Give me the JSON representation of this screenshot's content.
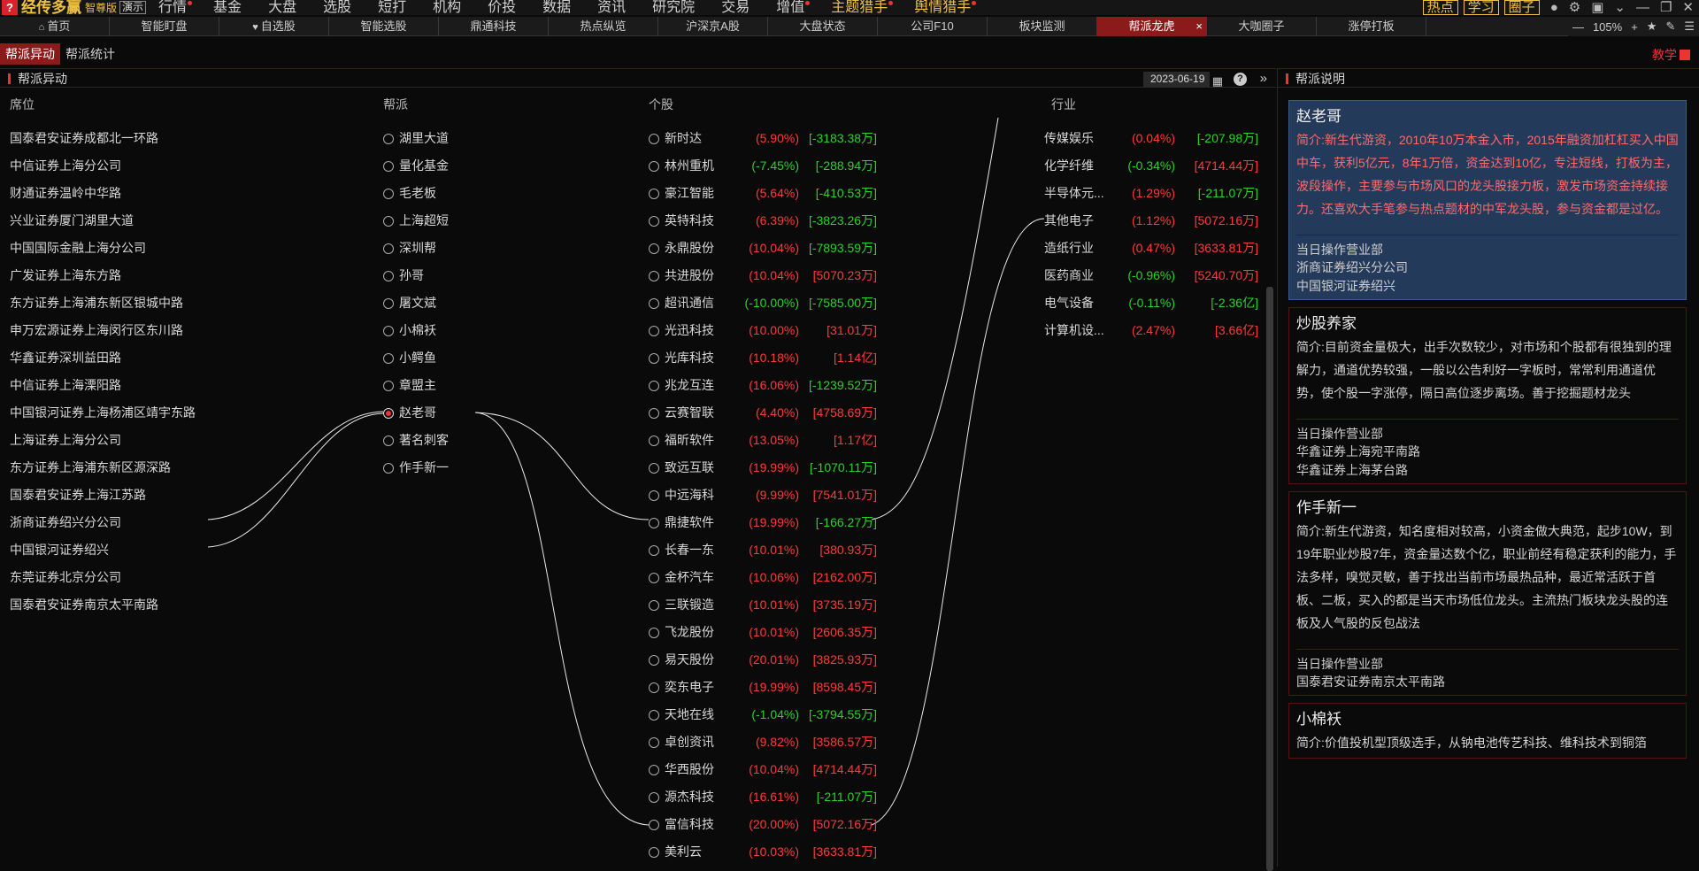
{
  "app": {
    "logo_mark": "?",
    "name": "经传多赢",
    "edition": "智尊版",
    "demo": "演示"
  },
  "menu": [
    {
      "label": "行情",
      "dot": true,
      "yellow": false
    },
    {
      "label": "基金",
      "dot": false,
      "yellow": false
    },
    {
      "label": "大盘",
      "dot": false,
      "yellow": false
    },
    {
      "label": "选股",
      "dot": false,
      "yellow": false
    },
    {
      "label": "短打",
      "dot": false,
      "yellow": false
    },
    {
      "label": "机构",
      "dot": false,
      "yellow": false
    },
    {
      "label": "价投",
      "dot": false,
      "yellow": false
    },
    {
      "label": "数据",
      "dot": false,
      "yellow": false
    },
    {
      "label": "资讯",
      "dot": false,
      "yellow": false
    },
    {
      "label": "研究院",
      "dot": false,
      "yellow": false
    },
    {
      "label": "交易",
      "dot": false,
      "yellow": false
    },
    {
      "label": "增值",
      "dot": true,
      "yellow": false
    },
    {
      "label": "主题猎手",
      "dot": true,
      "yellow": true
    },
    {
      "label": "舆情猎手",
      "dot": true,
      "yellow": true
    }
  ],
  "top_buttons": [
    "热点",
    "学习",
    "圈子"
  ],
  "tabs": [
    {
      "label": "首页",
      "icon": "⌂",
      "active": false
    },
    {
      "label": "智能盯盘",
      "icon": "",
      "active": false
    },
    {
      "label": "自选股",
      "icon": "♥",
      "active": false
    },
    {
      "label": "智能选股",
      "icon": "",
      "active": false
    },
    {
      "label": "鼎通科技",
      "icon": "",
      "active": false
    },
    {
      "label": "热点纵览",
      "icon": "",
      "active": false
    },
    {
      "label": "沪深京A股",
      "icon": "",
      "active": false
    },
    {
      "label": "大盘状态",
      "icon": "",
      "active": false
    },
    {
      "label": "公司F10",
      "icon": "",
      "active": false
    },
    {
      "label": "板块监测",
      "icon": "",
      "active": false
    },
    {
      "label": "帮派龙虎",
      "icon": "",
      "active": true
    },
    {
      "label": "大咖圈子",
      "icon": "",
      "active": false
    },
    {
      "label": "涨停打板",
      "icon": "",
      "active": false
    }
  ],
  "zoom": {
    "value": "105%"
  },
  "subtabs": [
    {
      "label": "帮派异动",
      "active": true
    },
    {
      "label": "帮派统计",
      "active": false
    }
  ],
  "teach_label": "教学",
  "left_panel": {
    "title": "帮派异动",
    "date": "2023-06-19",
    "col_headers": {
      "seat": "席位",
      "faction": "帮派",
      "stock": "个股",
      "industry": "行业"
    }
  },
  "seats": [
    "国泰君安证券成都北一环路",
    "中信证券上海分公司",
    "财通证券温岭中华路",
    "兴业证券厦门湖里大道",
    "中国国际金融上海分公司",
    "广发证券上海东方路",
    "东方证券上海浦东新区银城中路",
    "申万宏源证券上海闵行区东川路",
    "华鑫证券深圳益田路",
    "中信证券上海溧阳路",
    "中国银河证券上海杨浦区靖宇东路",
    "上海证券上海分公司",
    "东方证券上海浦东新区源深路",
    "国泰君安证券上海江苏路",
    "浙商证券绍兴分公司",
    "中国银河证券绍兴",
    "东莞证券北京分公司",
    "国泰君安证券南京太平南路"
  ],
  "factions": [
    {
      "name": "湖里大道",
      "selected": false
    },
    {
      "name": "量化基金",
      "selected": false
    },
    {
      "name": "毛老板",
      "selected": false
    },
    {
      "name": "上海超短",
      "selected": false
    },
    {
      "name": "深圳帮",
      "selected": false
    },
    {
      "name": "孙哥",
      "selected": false
    },
    {
      "name": "屠文斌",
      "selected": false
    },
    {
      "name": "小棉袄",
      "selected": false
    },
    {
      "name": "小鳄鱼",
      "selected": false
    },
    {
      "name": "章盟主",
      "selected": false
    },
    {
      "name": "赵老哥",
      "selected": true
    },
    {
      "name": "著名刺客",
      "selected": false
    },
    {
      "name": "作手新一",
      "selected": false
    }
  ],
  "stocks": [
    {
      "name": "新时达",
      "pct": "(5.90%)",
      "amt": "[-3183.38万]",
      "pct_color": "red",
      "amt_color": "green"
    },
    {
      "name": "林州重机",
      "pct": "(-7.45%)",
      "amt": "[-288.94万]",
      "pct_color": "green",
      "amt_color": "green"
    },
    {
      "name": "豪江智能",
      "pct": "(5.64%)",
      "amt": "[-410.53万]",
      "pct_color": "red",
      "amt_color": "green"
    },
    {
      "name": "英特科技",
      "pct": "(6.39%)",
      "amt": "[-3823.26万]",
      "pct_color": "red",
      "amt_color": "green"
    },
    {
      "name": "永鼎股份",
      "pct": "(10.04%)",
      "amt": "[-7893.59万]",
      "pct_color": "red",
      "amt_color": "green"
    },
    {
      "name": "共进股份",
      "pct": "(10.04%)",
      "amt": "[5070.23万]",
      "pct_color": "red",
      "amt_color": "red"
    },
    {
      "name": "超讯通信",
      "pct": "(-10.00%)",
      "amt": "[-7585.00万]",
      "pct_color": "green",
      "amt_color": "green"
    },
    {
      "name": "光迅科技",
      "pct": "(10.00%)",
      "amt": "[31.01万]",
      "pct_color": "red",
      "amt_color": "red"
    },
    {
      "name": "光库科技",
      "pct": "(10.18%)",
      "amt": "[1.14亿]",
      "pct_color": "red",
      "amt_color": "red"
    },
    {
      "name": "兆龙互连",
      "pct": "(16.06%)",
      "amt": "[-1239.52万]",
      "pct_color": "red",
      "amt_color": "green"
    },
    {
      "name": "云赛智联",
      "pct": "(4.40%)",
      "amt": "[4758.69万]",
      "pct_color": "red",
      "amt_color": "red"
    },
    {
      "name": "福昕软件",
      "pct": "(13.05%)",
      "amt": "[1.17亿]",
      "pct_color": "red",
      "amt_color": "red"
    },
    {
      "name": "致远互联",
      "pct": "(19.99%)",
      "amt": "[-1070.11万]",
      "pct_color": "red",
      "amt_color": "green"
    },
    {
      "name": "中远海科",
      "pct": "(9.99%)",
      "amt": "[7541.01万]",
      "pct_color": "red",
      "amt_color": "red"
    },
    {
      "name": "鼎捷软件",
      "pct": "(19.99%)",
      "amt": "[-166.27万]",
      "pct_color": "red",
      "amt_color": "green"
    },
    {
      "name": "长春一东",
      "pct": "(10.01%)",
      "amt": "[380.93万]",
      "pct_color": "red",
      "amt_color": "red"
    },
    {
      "name": "金杯汽车",
      "pct": "(10.06%)",
      "amt": "[2162.00万]",
      "pct_color": "red",
      "amt_color": "red"
    },
    {
      "name": "三联锻造",
      "pct": "(10.01%)",
      "amt": "[3735.19万]",
      "pct_color": "red",
      "amt_color": "red"
    },
    {
      "name": "飞龙股份",
      "pct": "(10.01%)",
      "amt": "[2606.35万]",
      "pct_color": "red",
      "amt_color": "red"
    },
    {
      "name": "易天股份",
      "pct": "(20.01%)",
      "amt": "[3825.93万]",
      "pct_color": "red",
      "amt_color": "red"
    },
    {
      "name": "奕东电子",
      "pct": "(19.99%)",
      "amt": "[8598.45万]",
      "pct_color": "red",
      "amt_color": "red"
    },
    {
      "name": "天地在线",
      "pct": "(-1.04%)",
      "amt": "[-3794.55万]",
      "pct_color": "green",
      "amt_color": "green"
    },
    {
      "name": "卓创资讯",
      "pct": "(9.82%)",
      "amt": "[3586.57万]",
      "pct_color": "red",
      "amt_color": "red"
    },
    {
      "name": "华西股份",
      "pct": "(10.04%)",
      "amt": "[4714.44万]",
      "pct_color": "red",
      "amt_color": "red"
    },
    {
      "name": "源杰科技",
      "pct": "(16.61%)",
      "amt": "[-211.07万]",
      "pct_color": "red",
      "amt_color": "green"
    },
    {
      "name": "富信科技",
      "pct": "(20.00%)",
      "amt": "[5072.16万]",
      "pct_color": "red",
      "amt_color": "red"
    },
    {
      "name": "美利云",
      "pct": "(10.03%)",
      "amt": "[3633.81万]",
      "pct_color": "red",
      "amt_color": "red"
    }
  ],
  "industries": [
    {
      "name": "传媒娱乐",
      "pct": "(0.04%)",
      "amt": "[-207.98万]",
      "pct_color": "red",
      "amt_color": "green"
    },
    {
      "name": "化学纤维",
      "pct": "(-0.34%)",
      "amt": "[4714.44万]",
      "pct_color": "green",
      "amt_color": "red"
    },
    {
      "name": "半导体元...",
      "pct": "(1.29%)",
      "amt": "[-211.07万]",
      "pct_color": "red",
      "amt_color": "green"
    },
    {
      "name": "其他电子",
      "pct": "(1.12%)",
      "amt": "[5072.16万]",
      "pct_color": "red",
      "amt_color": "red"
    },
    {
      "name": "造纸行业",
      "pct": "(0.47%)",
      "amt": "[3633.81万]",
      "pct_color": "red",
      "amt_color": "red"
    },
    {
      "name": "医药商业",
      "pct": "(-0.96%)",
      "amt": "[5240.70万]",
      "pct_color": "green",
      "amt_color": "red"
    },
    {
      "name": "电气设备",
      "pct": "(-0.11%)",
      "amt": "[-2.36亿]",
      "pct_color": "green",
      "amt_color": "green"
    },
    {
      "name": "计算机设...",
      "pct": "(2.47%)",
      "amt": "[3.66亿]",
      "pct_color": "red",
      "amt_color": "red"
    }
  ],
  "right_panel": {
    "title": "帮派说明",
    "cards": [
      {
        "name": "赵老哥",
        "selected": true,
        "intro": "简介:新生代游资，2010年10万本金入市，2015年融资加杠杠买入中国中车，获利5亿元，8年1万倍，资金达到10亿，专注短线，打板为主，波段操作，主要参与市场风口的龙头股接力板，激发市场资金持续接力。还喜欢大手笔参与热点题材的中军龙头股，参与资金都是过亿。",
        "sub": "当日操作营业部",
        "branches": [
          "浙商证券绍兴分公司",
          "中国银河证券绍兴"
        ]
      },
      {
        "name": "炒股养家",
        "selected": false,
        "intro": "简介:目前资金量极大，出手次数较少，对市场和个股都有很独到的理解力，通道优势较强，一般以公告利好一字板时，常常利用通道优势，使个股一字涨停，隔日高位逐步离场。善于挖掘题材龙头",
        "sub": "当日操作营业部",
        "branches": [
          "华鑫证券上海宛平南路",
          "华鑫证券上海茅台路"
        ]
      },
      {
        "name": "作手新一",
        "selected": false,
        "intro": "简介:新生代游资，知名度相对较高，小资金做大典范，起步10W，到19年职业炒股7年，资金量达数个亿，职业前经有稳定获利的能力，手法多样，嗅觉灵敏，善于找出当前市场最热品种，最近常活跃于首板、二板，买入的都是当天市场低位龙头。主流热门板块龙头股的连板及人气股的反包战法",
        "sub": "当日操作营业部",
        "branches": [
          "国泰君安证券南京太平南路"
        ]
      },
      {
        "name": "小棉袄",
        "selected": false,
        "intro": "简介:价值投机型顶级选手，从钠电池传艺科技、维科技术到铜箔",
        "sub": "",
        "branches": []
      }
    ]
  }
}
